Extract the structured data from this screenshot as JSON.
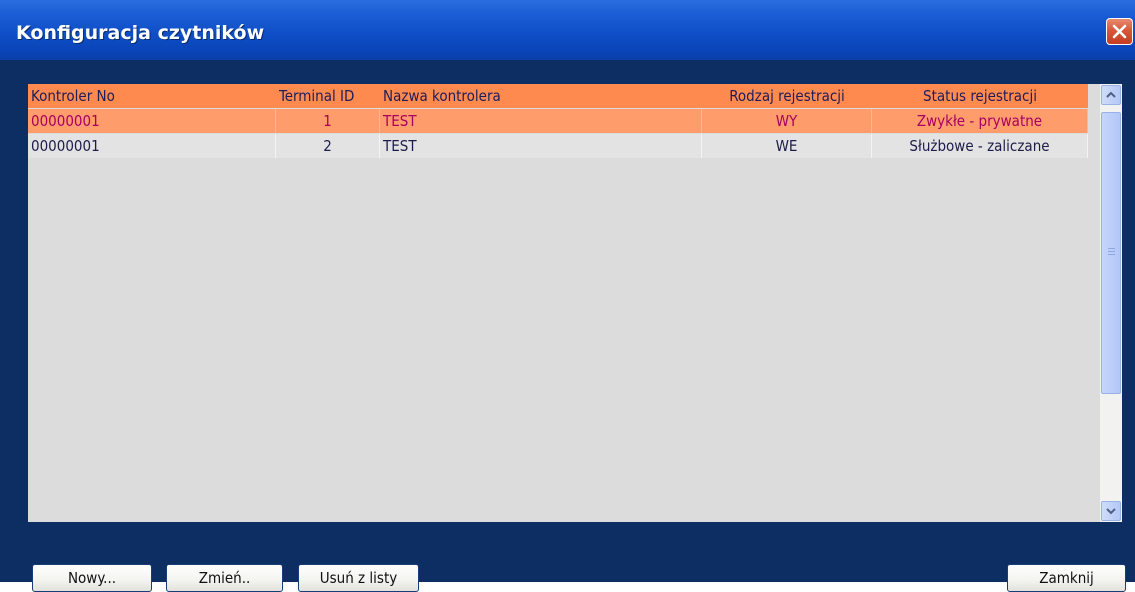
{
  "window": {
    "title": "Konfiguracja czytników"
  },
  "table": {
    "columns": [
      "Kontroler No",
      "Terminal ID",
      "Nazwa kontrolera",
      "Rodzaj rejestracji",
      "Status rejestracji"
    ],
    "rows": [
      {
        "kontroler": "00000001",
        "terminal": "1",
        "nazwa": "TEST",
        "rodzaj": "WY",
        "status": "Zwykłe - prywatne",
        "selected": true
      },
      {
        "kontroler": "00000001",
        "terminal": "2",
        "nazwa": "TEST",
        "rodzaj": "WE",
        "status": "Służbowe - zaliczane",
        "selected": false
      }
    ]
  },
  "buttons": {
    "new": "Nowy...",
    "edit": "Zmień..",
    "remove": "Usuń z listy",
    "close": "Zamknij"
  },
  "colors": {
    "header_bg": "#ff8a50",
    "selected_bg": "#ff9c6b",
    "selected_text": "#a80064",
    "window_bg": "#0c2e63",
    "titlebar": "#0f4fc7",
    "close_btn": "#d9573b"
  },
  "icons": {
    "close": "close-icon",
    "scroll_up": "chevron-up-icon",
    "scroll_down": "chevron-down-icon"
  }
}
